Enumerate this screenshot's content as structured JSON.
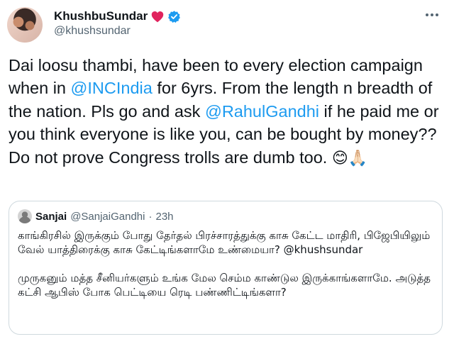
{
  "tweet": {
    "display_name": "KhushbuSundar",
    "handle": "@khushsundar",
    "text_part1": "Dai loosu thambi, have been to every election campaign when in ",
    "mention1": "@INCIndia",
    "text_part2": " for 6yrs. From the length n breadth of the nation. Pls go and ask ",
    "mention2": "@RahulGandhi",
    "text_part3": " if he paid me or you think everyone is like you, can be bought by money?? Do not prove Congress trolls are dumb too. ",
    "emojis": "😊🙏🏻"
  },
  "quoted_tweet": {
    "display_name": "Sanjai",
    "handle": "@SanjaiGandhi",
    "separator": "·",
    "time": "23h",
    "paragraph1": "காங்கிரசில் இருக்கும் போது தேர்தல் பிரச்சாரத்துக்கு காசு கேட்ட மாதிரி, பிஜேபியிலும் வேல் யாத்திரைக்கு காசு கேட்டிங்களாமே உண்மையா? @khushsundar",
    "paragraph2": "முருகனும் மத்த சீனியர்களும் உங்க மேல செம்ம காண்டுல இருக்காங்களாமே. அடுத்த கட்சி ஆபிஸ் போக பெட்டியை ரெடி பண்ணிட்டிங்களா?"
  },
  "icons": {
    "heart": "red-heart-icon",
    "verified": "verified-badge-icon",
    "more": "more-options-icon"
  },
  "colors": {
    "link": "#1d9bf0",
    "secondary_text": "#536471",
    "border": "#cfd9de",
    "heart": "#e0245e"
  }
}
